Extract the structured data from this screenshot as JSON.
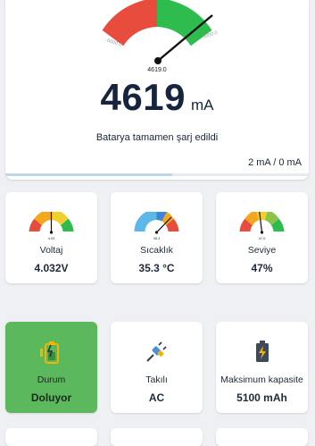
{
  "main_gauge": {
    "min_label": "-6000.0",
    "max_label": "6000.0",
    "center_label": "4619.0",
    "colors": {
      "red": "#e74c3c",
      "green": "#2ebc4f"
    }
  },
  "current": {
    "value": "4619",
    "unit": "mA"
  },
  "status_message": "Batarya tamamen şarj edildi",
  "current_readout": "2 mA / 0 mA",
  "progress_fraction": 0.55,
  "cards": [
    {
      "label": "Voltaj",
      "value": "4.032V",
      "gauge_label": "4.03",
      "icon": "voltage-gauge"
    },
    {
      "label": "Sıcaklık",
      "value": "35.3 °C",
      "gauge_label": "35.3",
      "icon": "temperature-gauge"
    },
    {
      "label": "Seviye",
      "value": "47%",
      "gauge_label": "47.0",
      "icon": "level-gauge"
    },
    {
      "label": "Durum",
      "value": "Doluyor",
      "icon": "battery-charging-icon",
      "accent": "#5cb85c"
    },
    {
      "label": "Takılı",
      "value": "AC",
      "icon": "plug-icon"
    },
    {
      "label": "Maksimum kapasite",
      "value": "5100 mAh",
      "icon": "battery-bolt-icon"
    }
  ]
}
